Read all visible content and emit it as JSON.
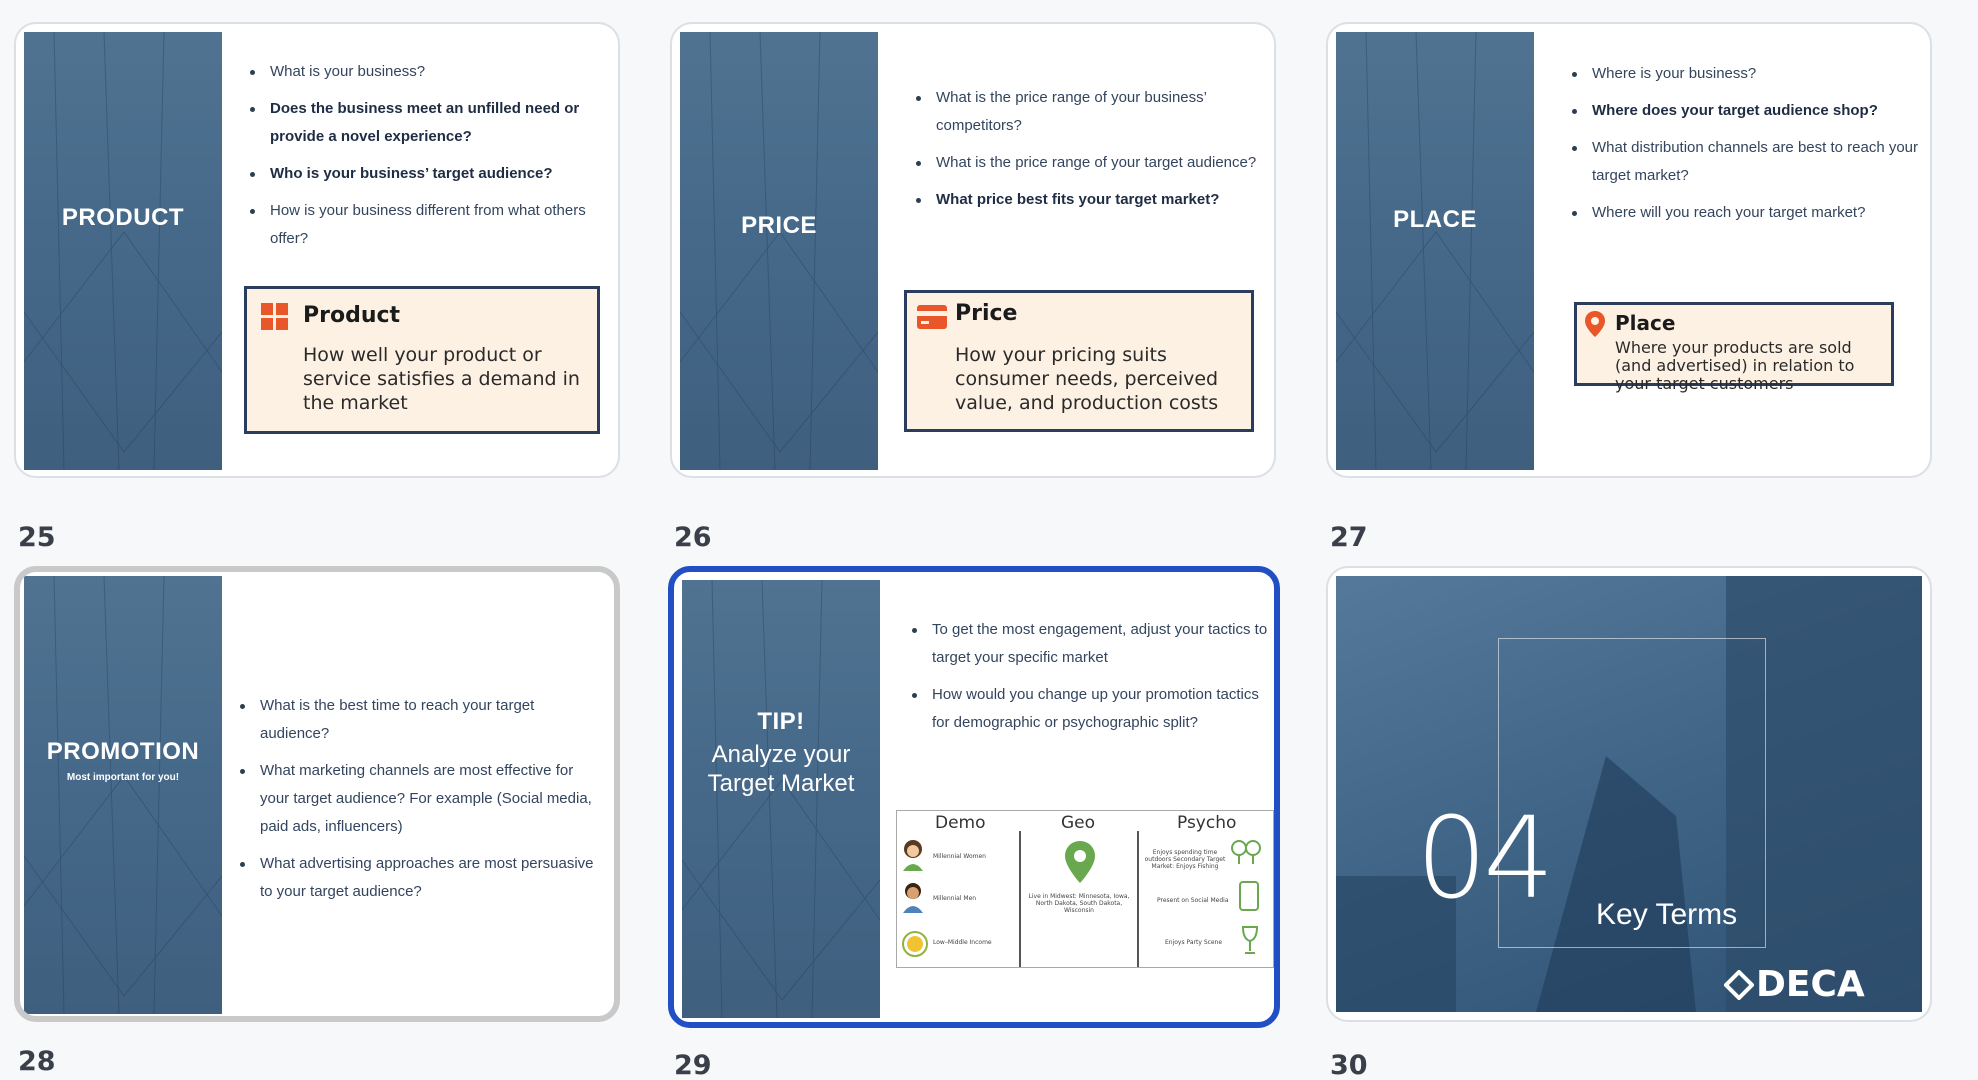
{
  "colors": {
    "accent_selected": "#2250c4",
    "panel_blue": "#46698a",
    "def_bg": "#fdf1e4",
    "def_border": "#2b3d5e",
    "icon_orange": "#e8562a"
  },
  "slides": [
    {
      "number": "25",
      "panel_title": "PRODUCT",
      "bullets": [
        "What is your business?",
        "Does the business meet an unfilled need or provide a novel experience?",
        "Who is your business’ target audience?",
        "How is your business different from what others offer?"
      ],
      "def_icon": "product-grid-icon",
      "def_title": "Product",
      "def_body": "How well your product or service satisfies a demand in the market"
    },
    {
      "number": "26",
      "panel_title": "PRICE",
      "bullets": [
        "What is the price range of your business’ competitors?",
        "What is the price range of your target audience?",
        "What price best fits your target market?"
      ],
      "def_icon": "credit-card-icon",
      "def_title": "Price",
      "def_body": "How your pricing suits consumer needs, perceived value, and production costs"
    },
    {
      "number": "27",
      "panel_title": "PLACE",
      "bullets": [
        "Where is your business?",
        "Where does your target audience shop?",
        "What distribution channels are best to reach your target market?",
        "Where will you reach your target market?"
      ],
      "def_icon": "map-pin-icon",
      "def_title": "Place",
      "def_body": "Where your products are sold (and advertised) in relation to your target customers"
    },
    {
      "number": "28",
      "panel_title": "PROMOTION",
      "panel_sub": "Most important for you!",
      "bullets": [
        "What is the best time to reach your target audience?",
        "What marketing channels are most effective for your target audience? For example (Social media, paid ads, influencers)",
        "What advertising approaches are most persuasive to your target audience?"
      ]
    },
    {
      "number": "29",
      "panel_title": "TIP!",
      "panel_sub": "Analyze your Target Market",
      "bullets": [
        "To get the most engagement, adjust your tactics to target your specific market",
        "How would you change up your promotion tactics for demographic or psychographic split?"
      ],
      "chart_headers": [
        "Demo",
        "Geo",
        "Psycho"
      ],
      "demo_rows": [
        "Millennial Women",
        "Millennial Men",
        "Low–Middle Income"
      ],
      "geo_text": "Live in Midwest: Minnesota, Iowa, North Dakota, South Dakota, Wisconsin",
      "psycho_rows": [
        "Enjoys spending time outdoors Secondary Target Market: Enjoys Fishing",
        "Present on Social Media",
        "Enjoys Party Scene"
      ]
    },
    {
      "number": "30",
      "big_number": "04",
      "section_title": "Key Terms",
      "brand": "DECA"
    }
  ]
}
